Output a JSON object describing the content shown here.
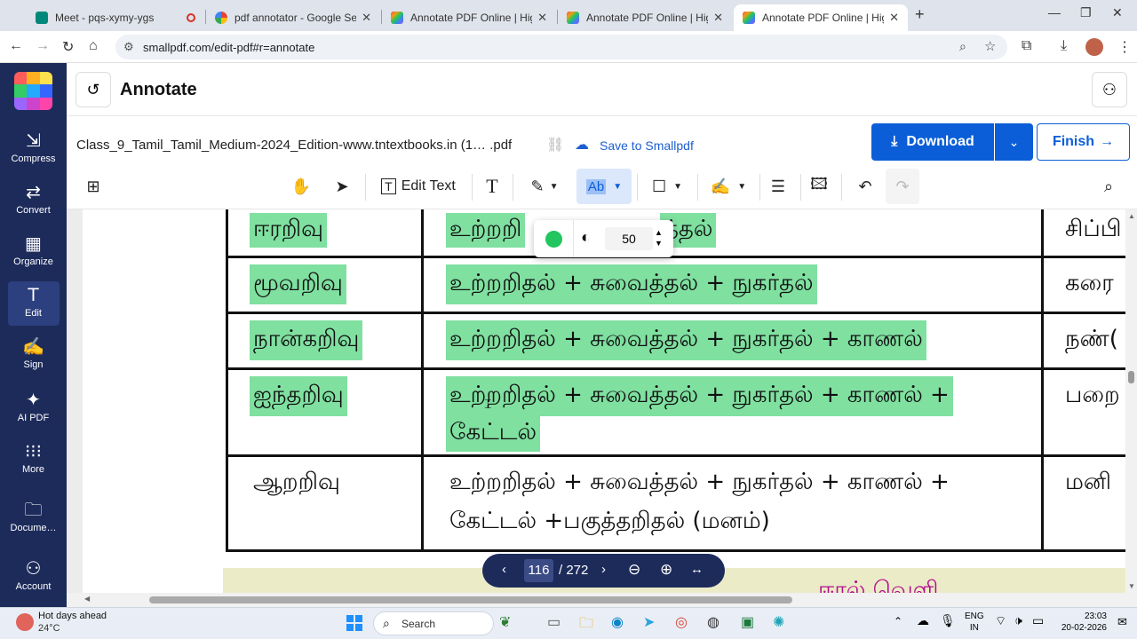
{
  "browser": {
    "tabs": [
      {
        "title": "Meet - pqs-xymy-ygs",
        "recording": true
      },
      {
        "title": "pdf annotator - Google Search"
      },
      {
        "title": "Annotate PDF Online | Highligh"
      },
      {
        "title": "Annotate PDF Online | Highligh"
      },
      {
        "title": "Annotate PDF Online | Highligh",
        "active": true
      }
    ],
    "new_tab": "+",
    "url": "smallpdf.com/edit-pdf#r=annotate"
  },
  "sidebar": {
    "items": [
      {
        "label": "Compress",
        "icon": "compress-icon"
      },
      {
        "label": "Convert",
        "icon": "convert-icon"
      },
      {
        "label": "Organize",
        "icon": "organize-icon"
      },
      {
        "label": "Edit",
        "icon": "edit-icon",
        "active": true
      },
      {
        "label": "Sign",
        "icon": "sign-icon"
      },
      {
        "label": "AI PDF",
        "icon": "sparkle-icon"
      },
      {
        "label": "More",
        "icon": "grid-dots-icon"
      },
      {
        "label": "Docume…",
        "icon": "folder-icon"
      },
      {
        "label": "Account",
        "icon": "user-icon"
      }
    ]
  },
  "header": {
    "title": "Annotate",
    "filename": "Class_9_Tamil_Tamil_Medium-2024_Edition-www.tntextbooks.in (1… .pdf",
    "save_label": "Save to Smallpdf",
    "download_label": "Download",
    "finish_label": "Finish"
  },
  "toolbar": {
    "edit_text_label": "Edit Text"
  },
  "highlight_popup": {
    "color": "#22c55e",
    "opacity": "50"
  },
  "table": {
    "rows": [
      {
        "col1": "ஈரறிவு",
        "col2a": "உற்றறி",
        "col2b": "த்தல்",
        "col3": "சிப்பி",
        "highlight": true
      },
      {
        "col1": "மூவறிவு",
        "col2a": "உற்றறிதல் + சுவைத்தல் + நுகர்தல்",
        "col3": "கரை",
        "highlight": true
      },
      {
        "col1": "நான்கறிவு",
        "col2a": "உற்றறிதல் + சுவைத்தல் + நுகர்தல் + காணல்",
        "col3": "நண்(",
        "highlight": true
      },
      {
        "col1": "ஐந்தறிவு",
        "col2a": "உற்றறிதல் + சுவைத்தல் + நுகர்தல் + காணல் +",
        "col2b": "கேட்டல்",
        "col3": "பறை",
        "highlight": true
      },
      {
        "col1": "ஆறறிவு",
        "col2a": "உற்றறிதல் + சுவைத்தல் + நுகர்தல் + காணல் +",
        "col2b": "கேட்டல் +பகுத்தறிதல் (மனம்)",
        "col3": "மனி",
        "highlight": false
      }
    ],
    "footer_partial": "ஈரல் வெளி"
  },
  "pager": {
    "current": "116",
    "total": "/ 272"
  },
  "taskbar": {
    "weather_title": "Hot days ahead",
    "weather_temp": "24°C",
    "search_label": "Search",
    "lang_top": "ENG",
    "lang_bottom": "IN",
    "time": "23:03",
    "date": "20-02-2026"
  },
  "colors": {
    "brand_blue": "#0b5ed7",
    "sidebar_bg": "#1d2b5b",
    "highlight_green": "#7fe0a0"
  }
}
